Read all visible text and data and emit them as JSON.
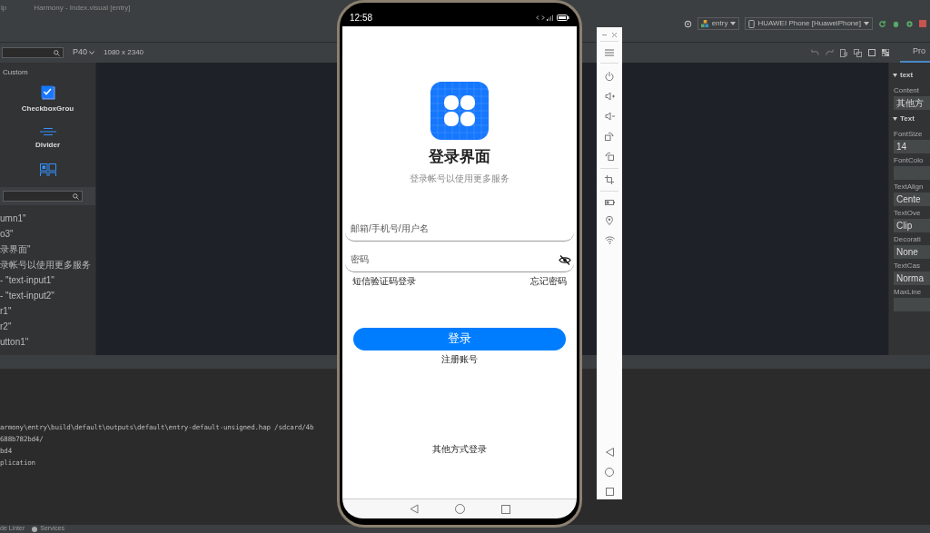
{
  "ide": {
    "title_bar": {
      "menu_fragment": "lp",
      "title": "Harmony - Index.visual [entry]"
    },
    "toolbar": {
      "module": "entry",
      "device": "HUAWEI Phone [HuaweiPhone]"
    },
    "preview_bar": {
      "device": "P40",
      "resolution": "1080 x 2340",
      "panel_tab": "Pro"
    },
    "palette": {
      "category": "Custom",
      "items": [
        {
          "kind": "checkbox",
          "label": "CheckboxGrou"
        },
        {
          "kind": "divider",
          "label": "Divider"
        },
        {
          "kind": "grid"
        }
      ]
    },
    "component_tree": [
      "umn1\"",
      "o3\"",
      "录界面\"",
      "录帐号以使用更多服务",
      "- \"text-input1\"",
      "- \"text-input2\"",
      "r1\"",
      "r2\"",
      "utton1\""
    ],
    "properties": {
      "sections": [
        {
          "title": "text",
          "fields": [
            {
              "label": "Content",
              "value": "其他方"
            }
          ]
        },
        {
          "title": "Text",
          "fields": [
            {
              "label": "FontSize",
              "value": "14"
            },
            {
              "label": "FontColo"
            },
            {
              "label": "TextAlign",
              "value": "Cente"
            },
            {
              "label": "TextOve",
              "value": "Clip"
            },
            {
              "label": "Decorati",
              "value": "None"
            },
            {
              "label": "TextCas",
              "value": "Norma"
            },
            {
              "label": "MaxLine"
            }
          ]
        }
      ]
    },
    "console": {
      "lines": [
        "armony\\entry\\build\\default\\outputs\\default\\entry-default-unsigned.hap /sdcard/4b",
        "688b782bd4/",
        "bd4",
        "plication"
      ]
    },
    "status_bar": {
      "tabs": [
        "de Linter",
        "Services"
      ]
    }
  },
  "phone": {
    "status": {
      "time": "12:58"
    },
    "app": {
      "title": "登录界面",
      "subtitle": "登录帐号以使用更多服务",
      "username": {
        "placeholder": "邮箱/手机号/用户名"
      },
      "password": {
        "placeholder": "密码"
      },
      "sms_login": "短信验证码登录",
      "forgot_password": "忘记密码",
      "login_button": "登录",
      "register": "注册账号",
      "other_login": "其他方式登录"
    }
  }
}
